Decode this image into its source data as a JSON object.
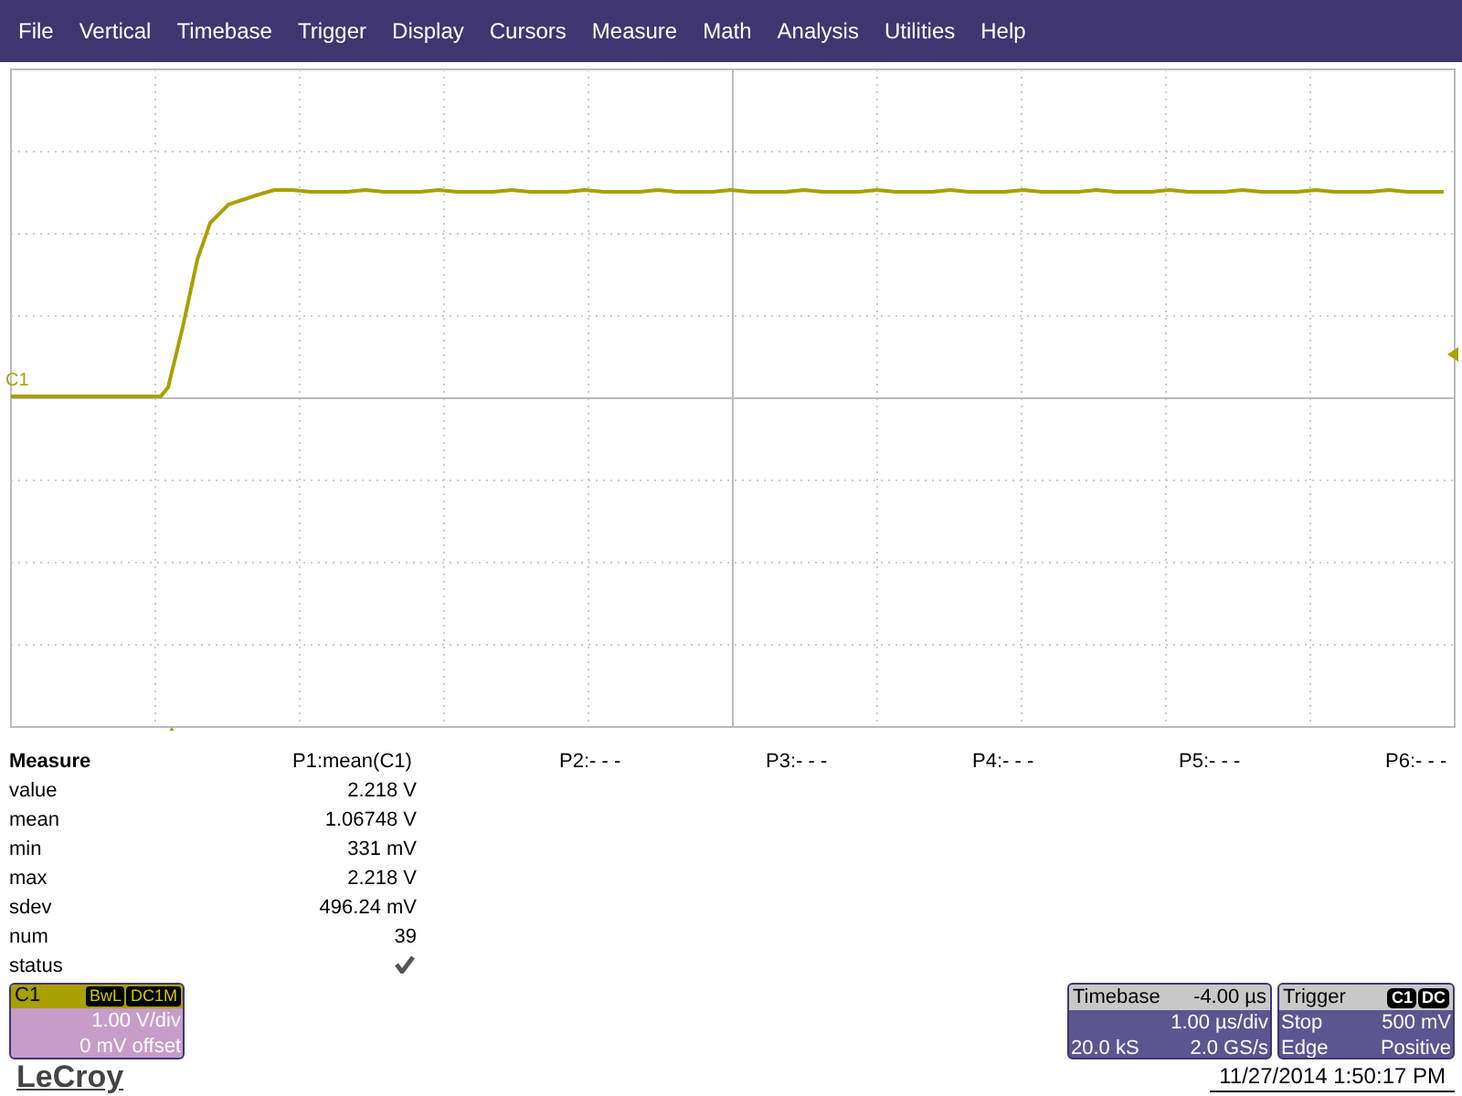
{
  "menu": [
    "File",
    "Vertical",
    "Timebase",
    "Trigger",
    "Display",
    "Cursors",
    "Measure",
    "Math",
    "Analysis",
    "Utilities",
    "Help"
  ],
  "grid": {
    "channel_label": "C1"
  },
  "measure": {
    "title": "Measure",
    "headers": [
      "P1:mean(C1)",
      "P2:- - -",
      "P3:- - -",
      "P4:- - -",
      "P5:- - -",
      "P6:- - -"
    ],
    "rows": [
      {
        "kind": "text",
        "label": "value",
        "value": "2.218 V"
      },
      {
        "kind": "text",
        "label": "mean",
        "value": "1.06748 V"
      },
      {
        "kind": "text",
        "label": "min",
        "value": "331 mV"
      },
      {
        "kind": "text",
        "label": "max",
        "value": "2.218 V"
      },
      {
        "kind": "text",
        "label": "sdev",
        "value": "496.24 mV"
      },
      {
        "kind": "text",
        "label": "num",
        "value": "39"
      },
      {
        "kind": "check",
        "label": "status"
      }
    ]
  },
  "channel": {
    "name": "C1",
    "tags": [
      "BwL",
      "DC1M"
    ],
    "lines": [
      "1.00 V/div",
      "0 mV offset"
    ]
  },
  "timebase": {
    "title": "Timebase",
    "value": "-4.00 µs",
    "rows": [
      {
        "right": "1.00 µs/div"
      },
      {
        "left": "20.0 kS",
        "right": "2.0 GS/s"
      }
    ]
  },
  "trigger": {
    "title": "Trigger",
    "tags": [
      "C1",
      "DC"
    ],
    "rows": [
      {
        "left": "Stop",
        "right": "500 mV"
      },
      {
        "left": "Edge",
        "right": "Positive"
      }
    ]
  },
  "brand": "LeCroy",
  "datetime": "11/27/2014 1:50:17 PM"
}
